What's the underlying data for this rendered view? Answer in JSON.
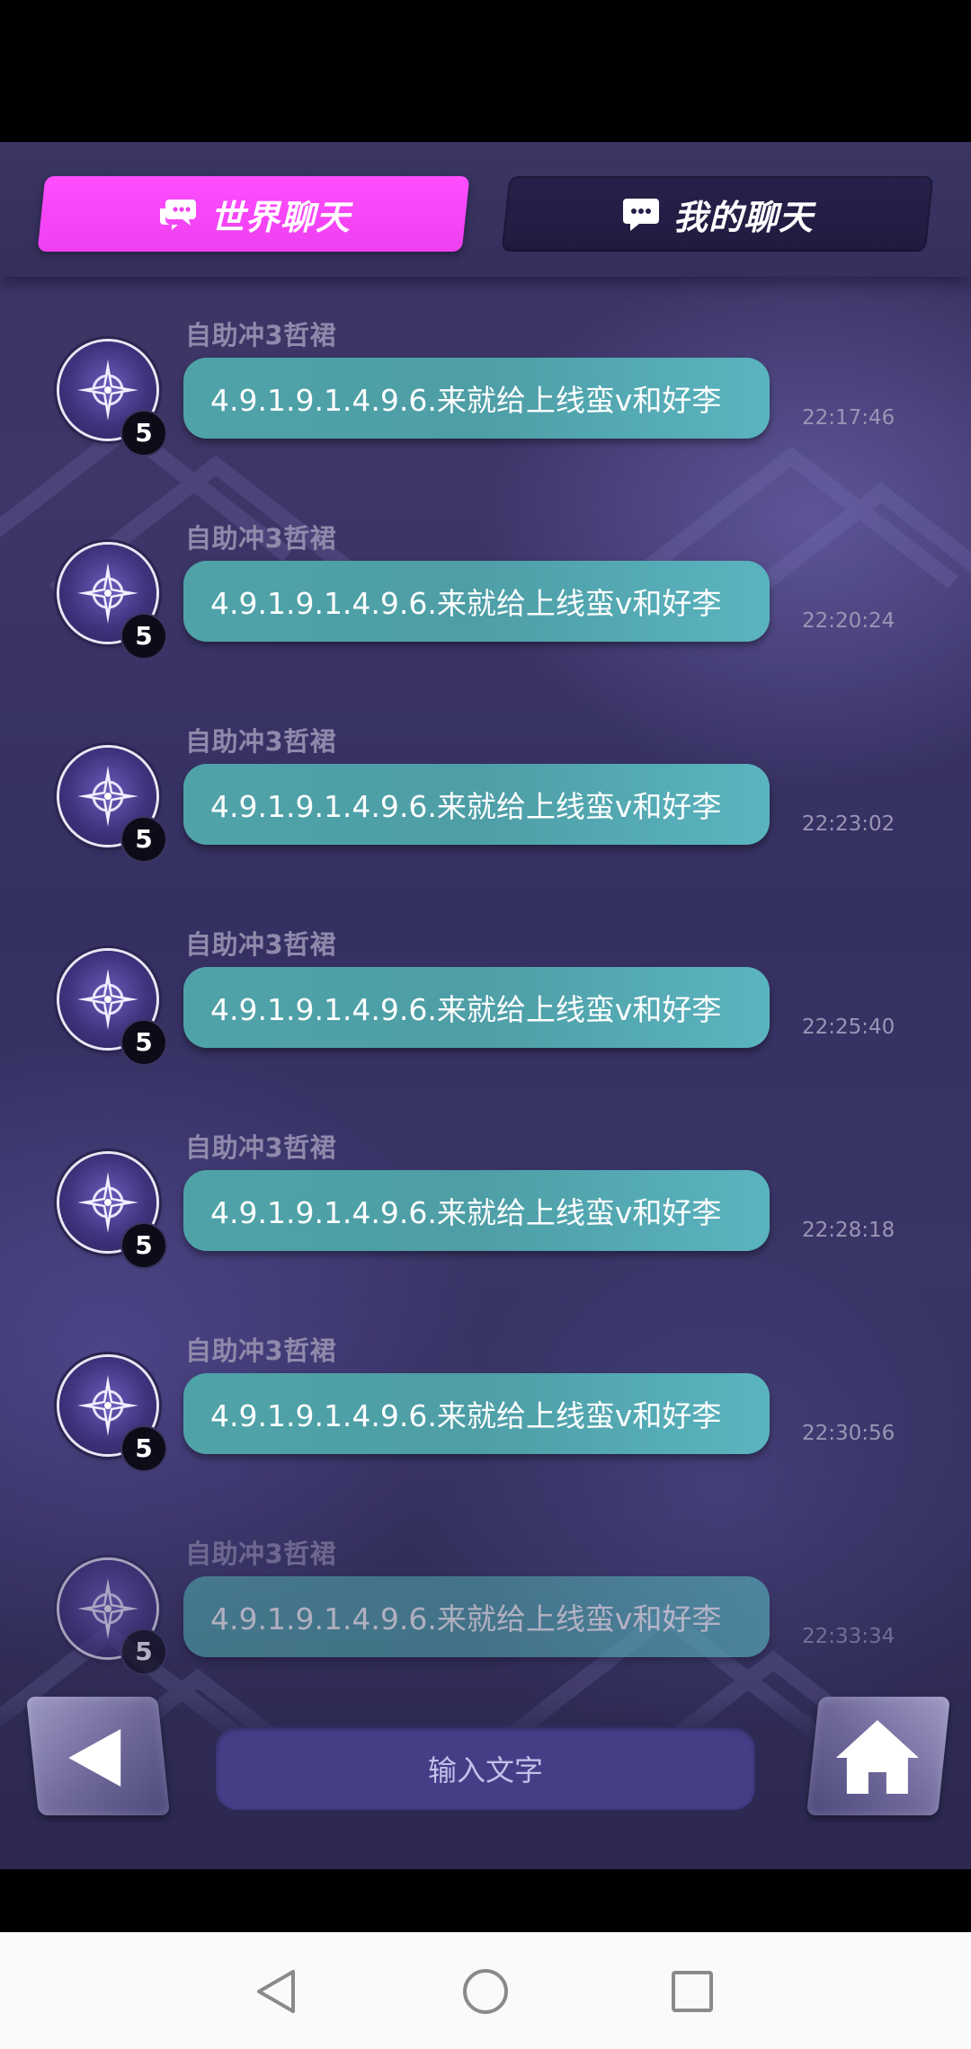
{
  "tabs": [
    {
      "label": "世界聊天",
      "active": true,
      "icon": "chat-bubbles-icon"
    },
    {
      "label": "我的聊天",
      "active": false,
      "icon": "chat-bubble-dots-icon"
    }
  ],
  "messages": [
    {
      "sender": "自助冲3哲裙",
      "level": "5",
      "text": "4.9.1.9.1.4.9.6.来就给上线蛮v和好李",
      "time": "22:17:46"
    },
    {
      "sender": "自助冲3哲裙",
      "level": "5",
      "text": "4.9.1.9.1.4.9.6.来就给上线蛮v和好李",
      "time": "22:20:24"
    },
    {
      "sender": "自助冲3哲裙",
      "level": "5",
      "text": "4.9.1.9.1.4.9.6.来就给上线蛮v和好李",
      "time": "22:23:02"
    },
    {
      "sender": "自助冲3哲裙",
      "level": "5",
      "text": "4.9.1.9.1.4.9.6.来就给上线蛮v和好李",
      "time": "22:25:40"
    },
    {
      "sender": "自助冲3哲裙",
      "level": "5",
      "text": "4.9.1.9.1.4.9.6.来就给上线蛮v和好李",
      "time": "22:28:18"
    },
    {
      "sender": "自助冲3哲裙",
      "level": "5",
      "text": "4.9.1.9.1.4.9.6.来就给上线蛮v和好李",
      "time": "22:30:56"
    },
    {
      "sender": "自助冲3哲裙",
      "level": "5",
      "text": "4.9.1.9.1.4.9.6.来就给上线蛮v和好李",
      "time": "22:33:34"
    }
  ],
  "input": {
    "placeholder": "输入文字"
  },
  "icons": {
    "back": "triangle-left-icon",
    "home": "house-icon",
    "avatar": "compass-star-icon"
  },
  "colors": {
    "active_tab": "#ff4dff",
    "inactive_tab": "#221e46",
    "bubble": "#4fa3a8",
    "background": "#3a3463",
    "input_box": "#433e86"
  }
}
